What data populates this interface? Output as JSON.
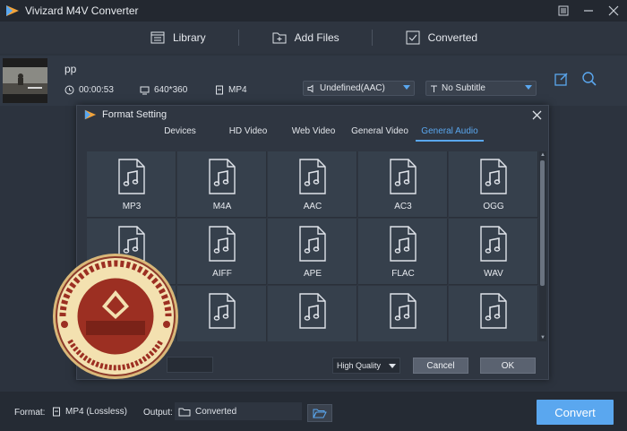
{
  "app": {
    "title": "Vivizard M4V Converter",
    "colors": {
      "accent": "#5aa7ef",
      "background": "#2b323d",
      "titlebar": "#232830"
    }
  },
  "topnav": {
    "items": [
      {
        "label": "Library",
        "icon": "library-icon"
      },
      {
        "label": "Add Files",
        "icon": "add-files-icon"
      },
      {
        "label": "Converted",
        "icon": "converted-icon"
      }
    ]
  },
  "file": {
    "name": "pp",
    "duration": "00:00:53",
    "resolution": "640*360",
    "format": "MP4",
    "audio_track": "Undefined(AAC)",
    "subtitle": "No Subtitle"
  },
  "format_dialog": {
    "title": "Format Setting",
    "tabs": [
      {
        "label": "Devices",
        "active": false
      },
      {
        "label": "HD Video",
        "active": false
      },
      {
        "label": "Web Video",
        "active": false
      },
      {
        "label": "General Video",
        "active": false
      },
      {
        "label": "General Audio",
        "active": true
      }
    ],
    "formats": [
      "MP3",
      "M4A",
      "AAC",
      "AC3",
      "OGG",
      "",
      "AIFF",
      "APE",
      "FLAC",
      "WAV",
      "",
      "",
      "",
      "",
      ""
    ],
    "quality": "High Quality",
    "cancel_label": "Cancel",
    "ok_label": "OK"
  },
  "bottom": {
    "format_label": "Format:",
    "format_value": "MP4 (Lossless)",
    "output_label": "Output:",
    "output_value": "Converted",
    "convert_label": "Convert"
  }
}
